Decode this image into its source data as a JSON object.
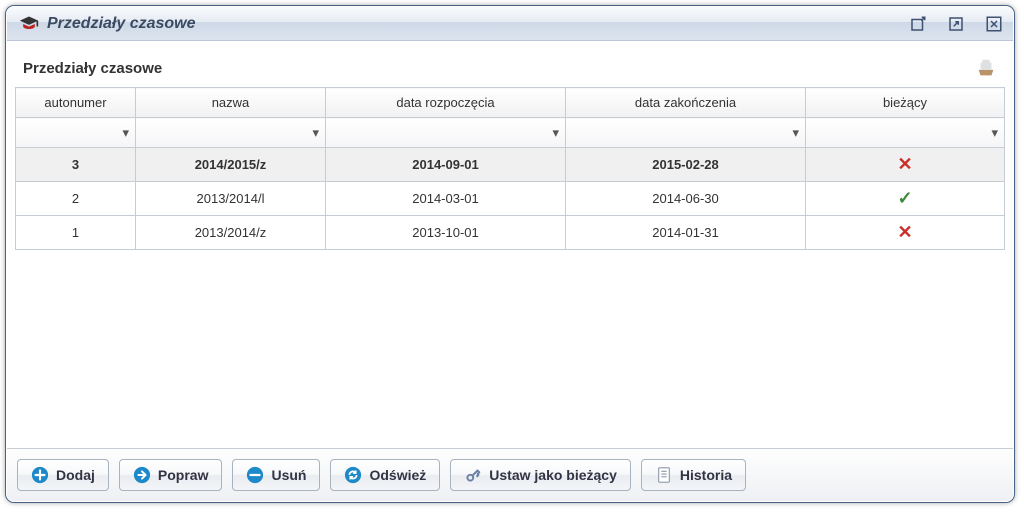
{
  "window": {
    "title": "Przedziały czasowe"
  },
  "subtitle": "Przedziały czasowe",
  "grid": {
    "columns": {
      "autonumer": "autonumer",
      "nazwa": "nazwa",
      "start": "data rozpoczęcia",
      "end": "data zakończenia",
      "current": "bieżący"
    },
    "rows": [
      {
        "auto": "3",
        "name": "2014/2015/z",
        "start": "2014-09-01",
        "end": "2015-02-28",
        "current": false,
        "selected": true
      },
      {
        "auto": "2",
        "name": "2013/2014/l",
        "start": "2014-03-01",
        "end": "2014-06-30",
        "current": true,
        "selected": false
      },
      {
        "auto": "1",
        "name": "2013/2014/z",
        "start": "2013-10-01",
        "end": "2014-01-31",
        "current": false,
        "selected": false
      }
    ]
  },
  "toolbar": {
    "add": "Dodaj",
    "edit": "Popraw",
    "delete": "Usuń",
    "refresh": "Odśwież",
    "set_current": "Ustaw jako bieżący",
    "history": "Historia"
  },
  "icons": {
    "app": "graduation-cap",
    "minimize": "minimize-icon",
    "maximize": "maximize-icon",
    "close": "close-icon",
    "top_right": "print-icon"
  },
  "colors": {
    "accent_blue": "#1d89c9",
    "x_red": "#c9302c",
    "check_green": "#3c8a3c"
  }
}
